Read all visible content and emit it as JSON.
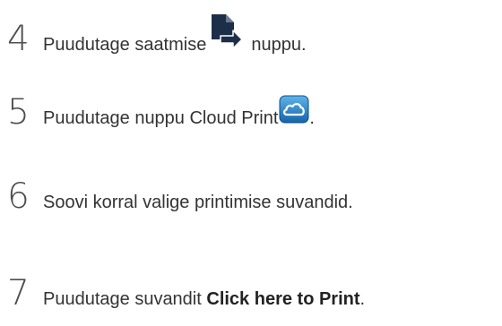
{
  "steps": [
    {
      "number": "4",
      "text_before": "Puudutage saatmise",
      "text_after": "nuppu.",
      "icon": "share-send-icon"
    },
    {
      "number": "5",
      "text_before": "Puudutage nuppu Cloud Print",
      "text_after": ".",
      "icon": "cloud-print-icon"
    },
    {
      "number": "6",
      "text": "Soovi korral valige printimise suvandid."
    },
    {
      "number": "7",
      "text_before": "Puudutage suvandit ",
      "bold": "Click here to Print",
      "text_after": "."
    }
  ],
  "colors": {
    "text": "#333333",
    "share_icon": "#1d2f48",
    "cloud_icon_blue": "#1f7fc4"
  }
}
